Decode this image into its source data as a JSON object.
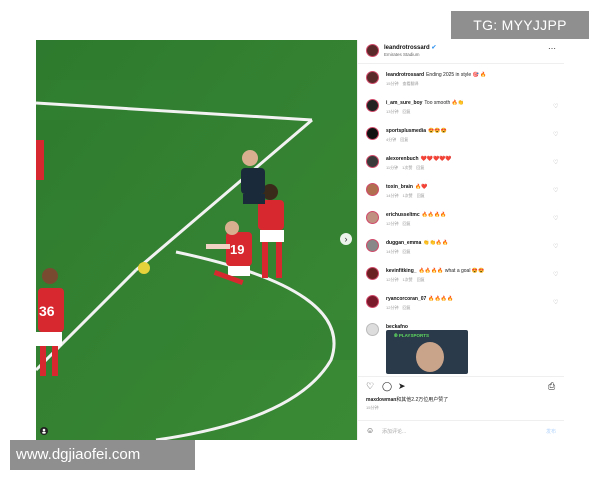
{
  "watermarks": {
    "top": "TG: MYYJJPP",
    "bottom": "www.dgjiaofei.com"
  },
  "post": {
    "username": "leandrotrossard",
    "verified_mark": "✔",
    "location": "Emirates Stadium",
    "more_icon": "⋯",
    "caption": "Ending 2025 in style 🎯 🔥",
    "caption_time": "15分钟",
    "caption_translate": "查看翻译",
    "player_numbers": [
      "36",
      "19"
    ],
    "embedded_badge": "⦾ PLAYSPORTS"
  },
  "comments": [
    {
      "user": "i_am_sure_boy",
      "text": "Too smooth 🔥👏",
      "time": "13分钟",
      "replies": "回复"
    },
    {
      "user": "sportsplusmedia",
      "text": "😍😍😍",
      "time": "4分钟",
      "replies": "回复"
    },
    {
      "user": "alexorenbuch",
      "text": "❤️❤️❤️❤️❤️",
      "time": "11分钟",
      "likes": "1次赞",
      "replies": "回复"
    },
    {
      "user": "toxin_brain",
      "text": "🔥❤️",
      "time": "14分钟",
      "likes": "1次赞",
      "replies": "回复"
    },
    {
      "user": "erichusseltmc",
      "text": "🔥🔥🔥🔥",
      "time": "12分钟",
      "replies": "回复"
    },
    {
      "user": "duggan_emma",
      "text": "👏👏🔥🔥",
      "time": "14分钟",
      "replies": "回复"
    },
    {
      "user": "kevinfitking_",
      "text": "🔥🔥🔥🔥 what a goal 😍😍",
      "time": "12分钟",
      "likes": "1次赞",
      "replies": "回复"
    },
    {
      "user": "ryancorcoran_07",
      "text": "🔥🔥🔥🔥",
      "time": "12分钟",
      "replies": "回复"
    },
    {
      "user": "beckafno",
      "text": "",
      "time": "",
      "replies": ""
    }
  ],
  "actions": {
    "like_icon": "♡",
    "comment_icon": "◯",
    "share_icon": "➤",
    "save_icon": "⎙"
  },
  "likes_text": "和其他2.2万位用户赞了",
  "likes_user": "maxdowman",
  "likes_time": "15分钟",
  "composer": {
    "emoji_icon": "☺",
    "placeholder": "添加评论...",
    "post_label": "发布"
  }
}
